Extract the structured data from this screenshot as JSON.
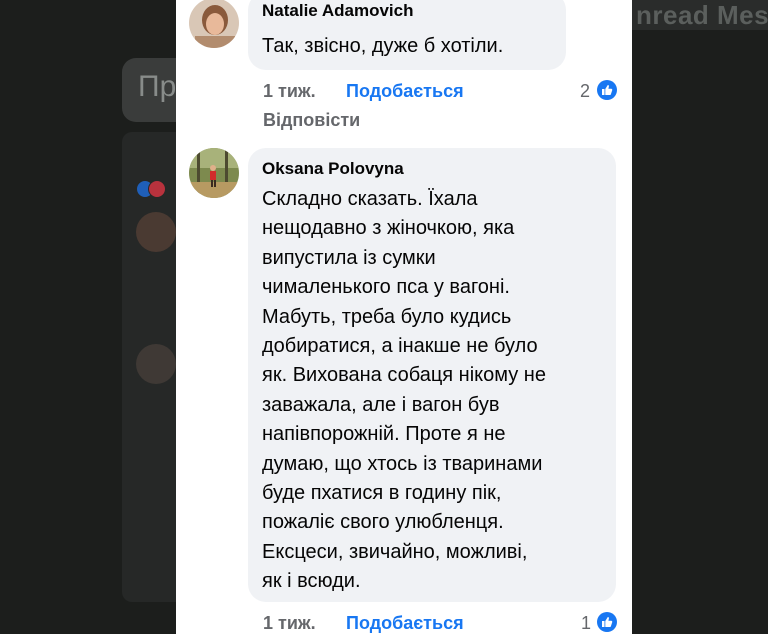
{
  "background": {
    "unread_label": "nread Mes",
    "card_text": "Пр"
  },
  "comments": [
    {
      "author": "Natalie Adamovich",
      "text": "Так, звісно, дуже б хотіли.",
      "time": "1 тиж.",
      "like_label": "Подобається",
      "reply_label": "Відповісти",
      "like_count": "2"
    },
    {
      "author": "Oksana Polovyna",
      "text_lines": [
        "Складно сказать. Їхала",
        "нещодавно з жіночкою, яка",
        "випустила із сумки",
        "чималенького пса у вагоні.",
        "Мабуть, треба було кудись",
        "добиратися, а інакше не було",
        "як. Вихована собаця нікому не",
        "заважала, але і вагон був",
        "напівпорожній. Проте я не",
        "думаю, що хтось із тваринами",
        "буде пхатися в годину пік,",
        "пожаліє свого улюбленця.",
        "Ексцеси, звичайно, можливі,",
        "як і всюди."
      ],
      "time": "1 тиж.",
      "like_label": "Подобається",
      "like_count": "1"
    }
  ],
  "colors": {
    "link": "#1877f2",
    "meta": "#65676b",
    "bubble": "#f0f2f5"
  }
}
